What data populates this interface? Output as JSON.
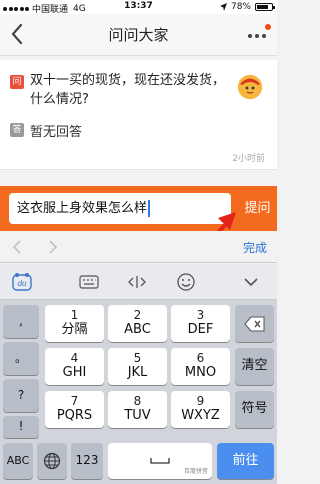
{
  "status": {
    "carrier": "中国联通",
    "network": "4G",
    "time": "13:37",
    "battery": "78%",
    "battery_level": 0.78
  },
  "nav": {
    "title": "问问大家",
    "back_icon": "chevron-left-icon",
    "more_icon": "more-dots-icon"
  },
  "question": {
    "q_tag": "问",
    "text": "双十一买的现货，现在还没发货，什么情况?",
    "a_tag": "答",
    "answer": "暂无回答",
    "time": "2小时前"
  },
  "ask": {
    "input_value": "这衣服上身效果怎么样",
    "button": "提问"
  },
  "accessory": {
    "done": "完成"
  },
  "ime_toolbar": {
    "logo": "du"
  },
  "keyboard": {
    "punct": [
      ",",
      "。",
      "?",
      "!"
    ],
    "row1": [
      {
        "num": "1",
        "label": "分隔"
      },
      {
        "num": "2",
        "label": "ABC"
      },
      {
        "num": "3",
        "label": "DEF"
      }
    ],
    "row2": [
      {
        "num": "4",
        "label": "GHI"
      },
      {
        "num": "5",
        "label": "JKL"
      },
      {
        "num": "6",
        "label": "MNO"
      }
    ],
    "row3": [
      {
        "num": "7",
        "label": "PQRS"
      },
      {
        "num": "8",
        "label": "TUV"
      },
      {
        "num": "9",
        "label": "WXYZ"
      }
    ],
    "clear": "清空",
    "symbol": "符号",
    "abc": "ABC",
    "num_key": "123",
    "space_brand": "百度拼音",
    "go": "前往"
  },
  "colors": {
    "accent": "#f26b1e",
    "link": "#2a73d8",
    "go_key": "#4a8ef0"
  }
}
